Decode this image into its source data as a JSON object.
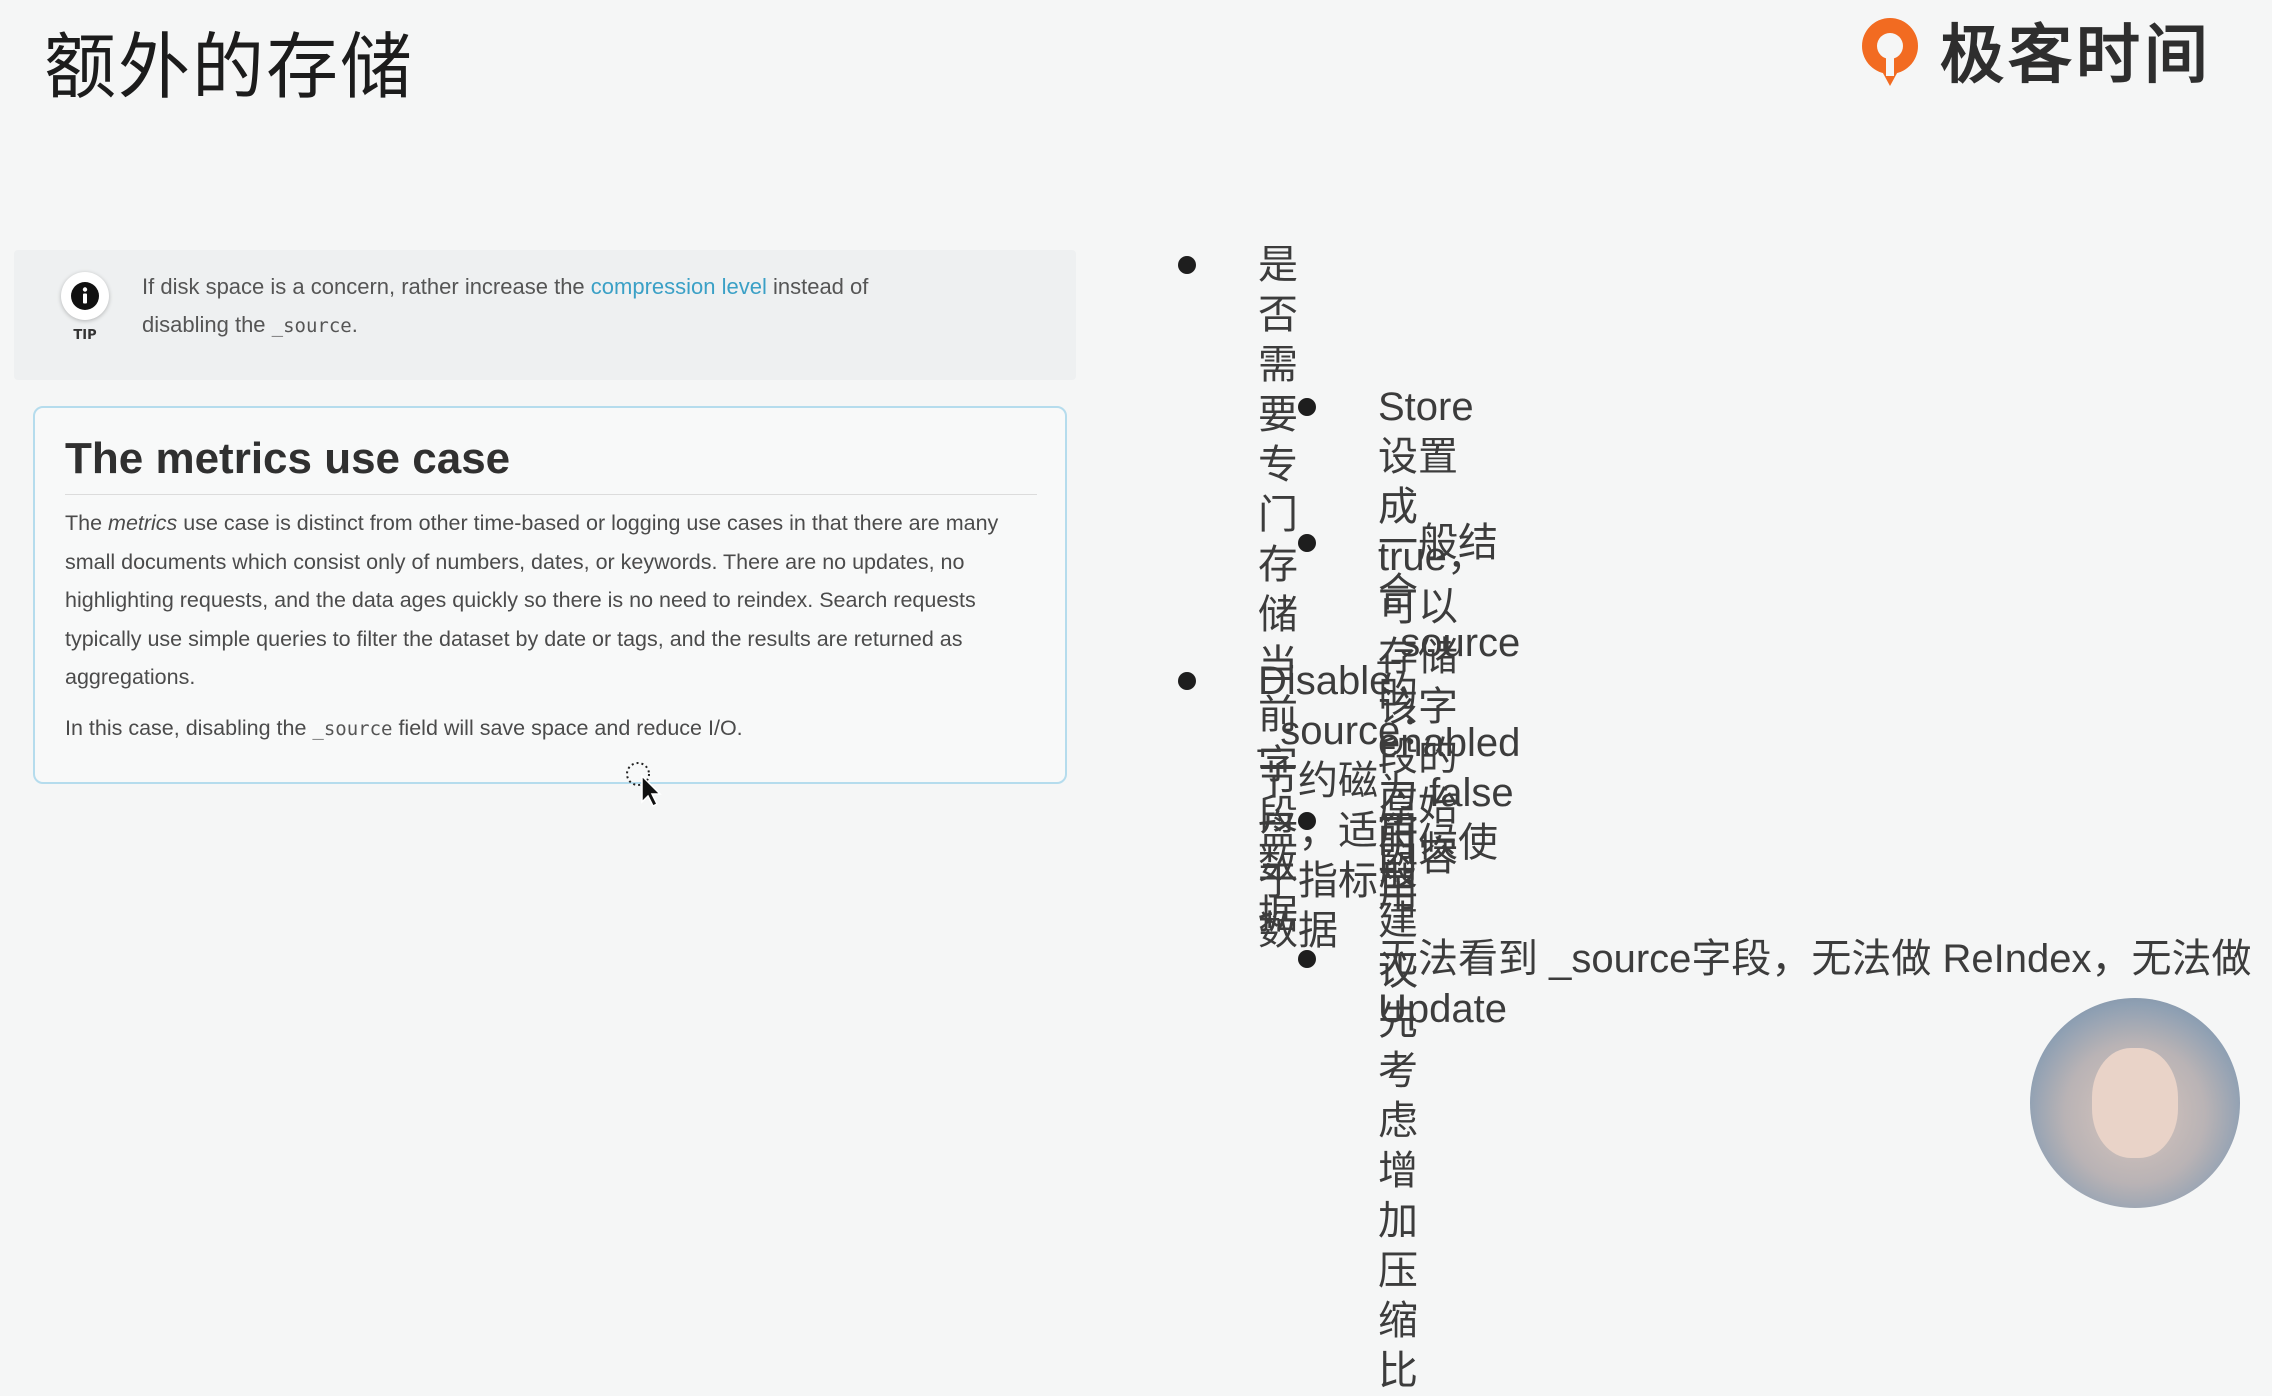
{
  "slide": {
    "title": "额外的存储"
  },
  "brand": {
    "name": "极客时间",
    "logo_color": "#f26b21"
  },
  "tip": {
    "label": "TIP",
    "text_before": "If disk space is a concern, rather increase the ",
    "link": "compression level",
    "text_after": " instead of",
    "line2_before": "disabling the ",
    "line2_code": "_source",
    "line2_after": "."
  },
  "metrics": {
    "heading": "The metrics use case",
    "p1_before": "The ",
    "p1_em": "metrics",
    "p1_after": " use case is distinct from other time-based or logging use cases in that there are many small documents which consist only of numbers, dates, or keywords. There are no updates, no highlighting requests, and the data ages quickly so there is no need to reindex. Search requests typically use simple queries to filter the dataset by date or tags, and the results are returned as aggregations.",
    "p2_before": "In this case, disabling the ",
    "p2_code": "_source",
    "p2_after": " field will save space and reduce I/O."
  },
  "bullets": [
    {
      "text": "是否需要专门存储当前字段数据",
      "level": 1
    },
    {
      "text": "Store 设置成 true，可以存储该字段的原始内容",
      "level": 2
    },
    {
      "text": "一般结合 _source 的 enabled 为 false 时候使用",
      "level": 2
    },
    {
      "text": "Disable _source：节约磁盘；适用于指标型数据",
      "level": 1
    },
    {
      "text": "一般建议先考虑增加压缩比",
      "level": 2
    },
    {
      "text": "无法看到 _source字段，无法做 ReIndex，无法做 Update",
      "level": 2
    }
  ]
}
